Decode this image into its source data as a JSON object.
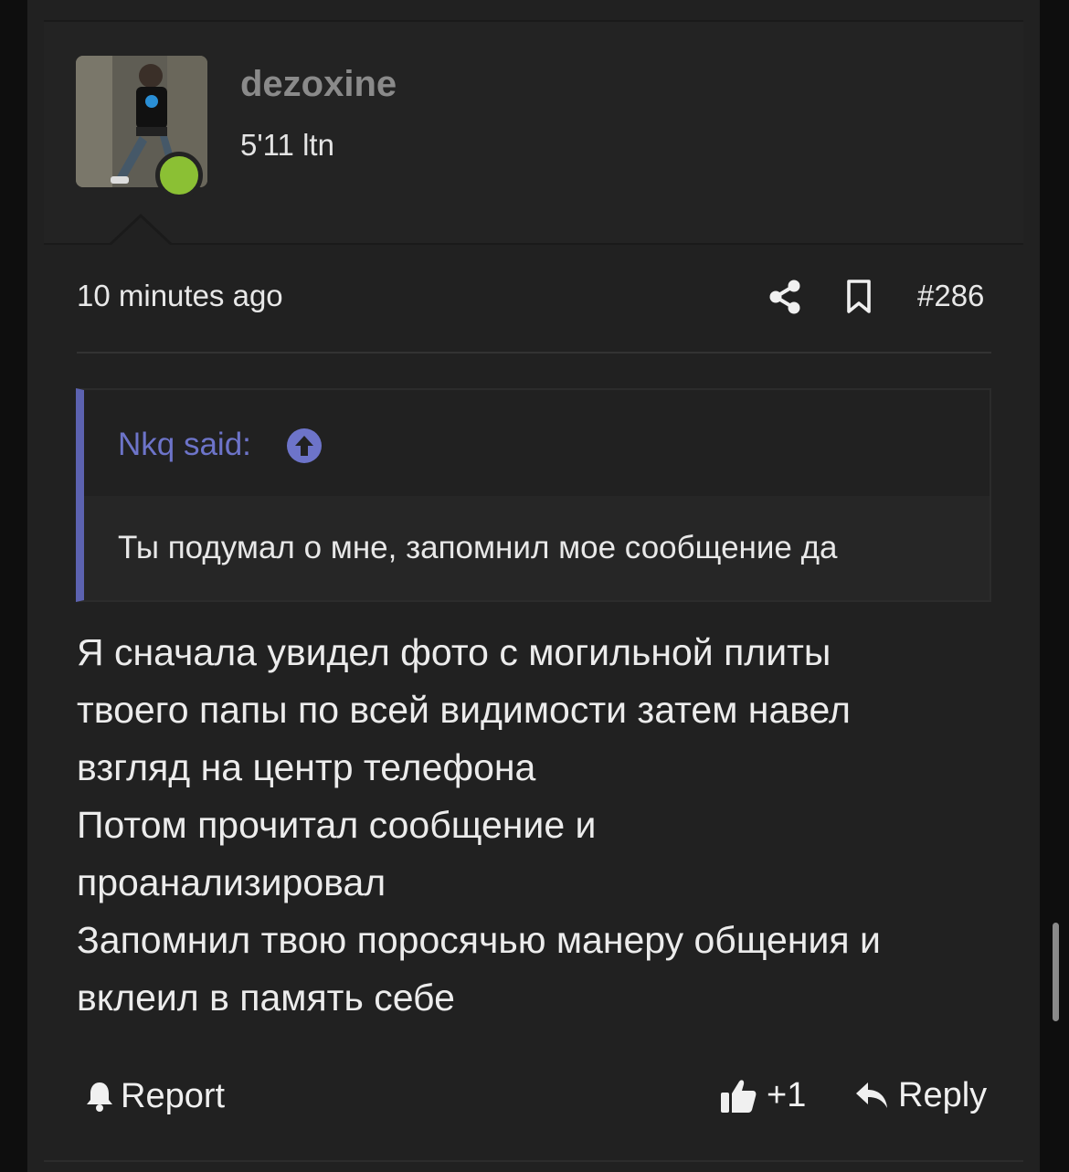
{
  "user": {
    "name": "dezoxine",
    "title": "5'11 ltn",
    "online": true,
    "avatar_icon": "user-avatar-photo"
  },
  "post": {
    "time": "10 minutes ago",
    "number": "#286",
    "icons": {
      "share": "share-icon",
      "bookmark": "bookmark-icon"
    }
  },
  "quote": {
    "author_label": "Nkq said:",
    "text": "Ты подумал о мне, запомнил мое сообщение да",
    "accent": "#5c62b0",
    "author_color": "#6d74c9"
  },
  "message": {
    "lines": [
      "Я сначала увидел фото с могильной плиты",
      "твоего папы по всей видимости затем навел",
      "взгляд на центр телефона",
      "Потом прочитал сообщение и",
      "проанализировал",
      "Запомнил твою поросячью манеру общения и",
      "вклеил в память себе"
    ]
  },
  "actions": {
    "report_label": "Report",
    "like_count": "+1",
    "reply_label": "Reply"
  },
  "colors": {
    "background": "#212121",
    "online": "#8bc034"
  }
}
